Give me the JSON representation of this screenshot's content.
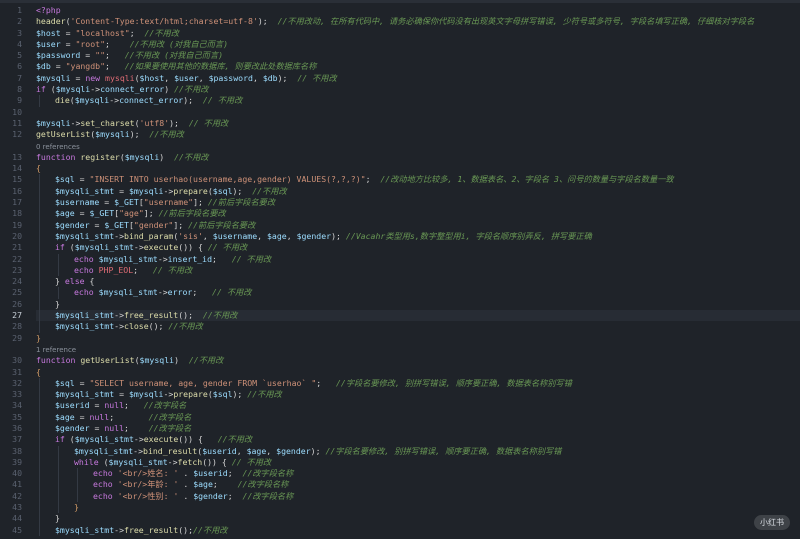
{
  "editor": {
    "lines": [
      {
        "n": "1",
        "tokens": [
          [
            "k",
            "<?php"
          ]
        ]
      },
      {
        "n": "2",
        "tokens": [
          [
            "f",
            "header"
          ],
          [
            "o",
            "("
          ],
          [
            "s",
            "'Content-Type:text/html;charset=utf-8'"
          ],
          [
            "o",
            ");  "
          ],
          [
            "c",
            "//不用改动, 在所有代码中, 请务必确保你代码没有出现英文字母拼写错误, 少符号或多符号, 字段名填写正确, 仔细核对字段名"
          ]
        ]
      },
      {
        "n": "3",
        "tokens": [
          [
            "v",
            "$host"
          ],
          [
            "o",
            " = "
          ],
          [
            "s",
            "\"localhost\""
          ],
          [
            "o",
            ";  "
          ],
          [
            "c",
            "//不用改"
          ]
        ]
      },
      {
        "n": "4",
        "tokens": [
          [
            "v",
            "$user"
          ],
          [
            "o",
            " = "
          ],
          [
            "s",
            "\"root\""
          ],
          [
            "o",
            ";    "
          ],
          [
            "c",
            "//不用改 (对我自己而言)"
          ]
        ]
      },
      {
        "n": "5",
        "tokens": [
          [
            "v",
            "$password"
          ],
          [
            "o",
            " = "
          ],
          [
            "s",
            "\"\""
          ],
          [
            "o",
            ";   "
          ],
          [
            "c",
            "//不用改 (对我自己而言)"
          ]
        ]
      },
      {
        "n": "6",
        "tokens": [
          [
            "v",
            "$db"
          ],
          [
            "o",
            " = "
          ],
          [
            "s",
            "\"yangdb\""
          ],
          [
            "o",
            ";   "
          ],
          [
            "c",
            "//如果要使用其他的数据库, 则要改此处数据库名称"
          ]
        ]
      },
      {
        "n": "7",
        "tokens": [
          [
            "v",
            "$mysqli"
          ],
          [
            "o",
            " = "
          ],
          [
            "k",
            "new "
          ],
          [
            "r",
            "mysqli"
          ],
          [
            "o",
            "("
          ],
          [
            "v",
            "$host"
          ],
          [
            "o",
            ", "
          ],
          [
            "v",
            "$user"
          ],
          [
            "o",
            ", "
          ],
          [
            "v",
            "$password"
          ],
          [
            "o",
            ", "
          ],
          [
            "v",
            "$db"
          ],
          [
            "o",
            ");  "
          ],
          [
            "c",
            "// 不用改"
          ]
        ]
      },
      {
        "n": "8",
        "tokens": [
          [
            "k",
            "if "
          ],
          [
            "o",
            "("
          ],
          [
            "v",
            "$mysqli"
          ],
          [
            "o",
            "->"
          ],
          [
            "v",
            "connect_error"
          ],
          [
            "o",
            ") "
          ],
          [
            "c",
            "//不用改"
          ]
        ]
      },
      {
        "n": "9",
        "indent": 1,
        "tokens": [
          [
            "f",
            "die"
          ],
          [
            "o",
            "("
          ],
          [
            "v",
            "$mysqli"
          ],
          [
            "o",
            "->"
          ],
          [
            "v",
            "connect_error"
          ],
          [
            "o",
            ");  "
          ],
          [
            "c",
            "// 不用改"
          ]
        ]
      },
      {
        "n": "10",
        "tokens": []
      },
      {
        "n": "11",
        "tokens": [
          [
            "v",
            "$mysqli"
          ],
          [
            "o",
            "->"
          ],
          [
            "f",
            "set_charset"
          ],
          [
            "o",
            "("
          ],
          [
            "s",
            "'utf8'"
          ],
          [
            "o",
            ");  "
          ],
          [
            "c",
            "// 不用改"
          ]
        ]
      },
      {
        "n": "12",
        "tokens": [
          [
            "f",
            "getUserList"
          ],
          [
            "o",
            "("
          ],
          [
            "v",
            "$mysqli"
          ],
          [
            "o",
            ");  "
          ],
          [
            "c",
            "//不用改"
          ]
        ]
      },
      {
        "ref": "0 references"
      },
      {
        "n": "13",
        "tokens": [
          [
            "k",
            "function "
          ],
          [
            "f",
            "register"
          ],
          [
            "o",
            "("
          ],
          [
            "v",
            "$mysqli"
          ],
          [
            "o",
            ")  "
          ],
          [
            "c",
            "//不用改"
          ]
        ]
      },
      {
        "n": "14",
        "tokens": [
          [
            "b",
            "{"
          ]
        ]
      },
      {
        "n": "15",
        "indent": 1,
        "tokens": [
          [
            "v",
            "$sql"
          ],
          [
            "o",
            " = "
          ],
          [
            "s",
            "\"INSERT INTO userhao(username,age,gender) VALUES(?,?,?)\""
          ],
          [
            "o",
            ";  "
          ],
          [
            "c",
            "//改动地方比较多, 1、数据表名、2、字段名 3、问号的数量与字段名数量一致"
          ]
        ]
      },
      {
        "n": "16",
        "indent": 1,
        "tokens": [
          [
            "v",
            "$mysqli_stmt"
          ],
          [
            "o",
            " = "
          ],
          [
            "v",
            "$mysqli"
          ],
          [
            "o",
            "->"
          ],
          [
            "f",
            "prepare"
          ],
          [
            "o",
            "("
          ],
          [
            "v",
            "$sql"
          ],
          [
            "o",
            ");  "
          ],
          [
            "c",
            "//不用改"
          ]
        ]
      },
      {
        "n": "17",
        "indent": 1,
        "tokens": [
          [
            "v",
            "$username"
          ],
          [
            "o",
            " = "
          ],
          [
            "v",
            "$_GET"
          ],
          [
            "o",
            "["
          ],
          [
            "s",
            "\"username\""
          ],
          [
            "o",
            "]; "
          ],
          [
            "c",
            "//前后字段名要改"
          ]
        ]
      },
      {
        "n": "18",
        "indent": 1,
        "tokens": [
          [
            "v",
            "$age"
          ],
          [
            "o",
            " = "
          ],
          [
            "v",
            "$_GET"
          ],
          [
            "o",
            "["
          ],
          [
            "s",
            "\"age\""
          ],
          [
            "o",
            "]; "
          ],
          [
            "c",
            "//前后字段名要改"
          ]
        ]
      },
      {
        "n": "19",
        "indent": 1,
        "tokens": [
          [
            "v",
            "$gender"
          ],
          [
            "o",
            " = "
          ],
          [
            "v",
            "$_GET"
          ],
          [
            "o",
            "["
          ],
          [
            "s",
            "\"gender\""
          ],
          [
            "o",
            "]; "
          ],
          [
            "c",
            "//前后字段名要改"
          ]
        ]
      },
      {
        "n": "20",
        "indent": 1,
        "tokens": [
          [
            "v",
            "$mysqli_stmt"
          ],
          [
            "o",
            "->"
          ],
          [
            "f",
            "bind_param"
          ],
          [
            "o",
            "("
          ],
          [
            "s",
            "'sis'"
          ],
          [
            "o",
            ", "
          ],
          [
            "v",
            "$username"
          ],
          [
            "o",
            ", "
          ],
          [
            "v",
            "$age"
          ],
          [
            "o",
            ", "
          ],
          [
            "v",
            "$gender"
          ],
          [
            "o",
            "); "
          ],
          [
            "c",
            "//Vacahr类型用s,数字整型用i, 字段名顺序别弄反, 拼写要正确"
          ]
        ]
      },
      {
        "n": "21",
        "indent": 1,
        "tokens": [
          [
            "k",
            "if "
          ],
          [
            "o",
            "("
          ],
          [
            "v",
            "$mysqli_stmt"
          ],
          [
            "o",
            "->"
          ],
          [
            "f",
            "execute"
          ],
          [
            "o",
            "()) { "
          ],
          [
            "c",
            "// 不用改"
          ]
        ]
      },
      {
        "n": "22",
        "indent": 2,
        "tokens": [
          [
            "k",
            "echo "
          ],
          [
            "v",
            "$mysqli_stmt"
          ],
          [
            "o",
            "->"
          ],
          [
            "v",
            "insert_id"
          ],
          [
            "o",
            ";   "
          ],
          [
            "c",
            "// 不用改"
          ]
        ]
      },
      {
        "n": "23",
        "indent": 2,
        "tokens": [
          [
            "k",
            "echo "
          ],
          [
            "r",
            "PHP_EOL"
          ],
          [
            "o",
            ";   "
          ],
          [
            "c",
            "// 不用改"
          ]
        ]
      },
      {
        "n": "24",
        "indent": 1,
        "tokens": [
          [
            "o",
            "} "
          ],
          [
            "k",
            "else "
          ],
          [
            "o",
            "{"
          ]
        ]
      },
      {
        "n": "25",
        "indent": 2,
        "tokens": [
          [
            "k",
            "echo "
          ],
          [
            "v",
            "$mysqli_stmt"
          ],
          [
            "o",
            "->"
          ],
          [
            "v",
            "error"
          ],
          [
            "o",
            ";   "
          ],
          [
            "c",
            "// 不用改"
          ]
        ]
      },
      {
        "n": "26",
        "indent": 1,
        "tokens": [
          [
            "o",
            "}"
          ]
        ]
      },
      {
        "n": "27",
        "indent": 1,
        "active": true,
        "tokens": [
          [
            "v",
            "$mysqli_stmt"
          ],
          [
            "o",
            "->"
          ],
          [
            "f",
            "free_result"
          ],
          [
            "o",
            "();  "
          ],
          [
            "c",
            "//不用改"
          ]
        ]
      },
      {
        "n": "28",
        "indent": 1,
        "tokens": [
          [
            "v",
            "$mysqli_stmt"
          ],
          [
            "o",
            "->"
          ],
          [
            "f",
            "close"
          ],
          [
            "o",
            "(); "
          ],
          [
            "c",
            "//不用改"
          ]
        ]
      },
      {
        "n": "29",
        "tokens": [
          [
            "b",
            "}"
          ]
        ]
      },
      {
        "ref": "1 reference"
      },
      {
        "n": "30",
        "tokens": [
          [
            "k",
            "function "
          ],
          [
            "f",
            "getUserList"
          ],
          [
            "o",
            "("
          ],
          [
            "v",
            "$mysqli"
          ],
          [
            "o",
            ")  "
          ],
          [
            "c",
            "//不用改"
          ]
        ]
      },
      {
        "n": "31",
        "tokens": [
          [
            "b",
            "{"
          ]
        ]
      },
      {
        "n": "32",
        "indent": 1,
        "tokens": [
          [
            "v",
            "$sql"
          ],
          [
            "o",
            " = "
          ],
          [
            "s",
            "\"SELECT username, age, gender FROM `userhao` \""
          ],
          [
            "o",
            ";   "
          ],
          [
            "c",
            "//字段名要修改, 别拼写错误, 顺序要正确, 数据表名称别写错"
          ]
        ]
      },
      {
        "n": "33",
        "indent": 1,
        "tokens": [
          [
            "v",
            "$mysqli_stmt"
          ],
          [
            "o",
            " = "
          ],
          [
            "v",
            "$mysqli"
          ],
          [
            "o",
            "->"
          ],
          [
            "f",
            "prepare"
          ],
          [
            "o",
            "("
          ],
          [
            "v",
            "$sql"
          ],
          [
            "o",
            "); "
          ],
          [
            "c",
            "//不用改"
          ]
        ]
      },
      {
        "n": "34",
        "indent": 1,
        "tokens": [
          [
            "v",
            "$userid"
          ],
          [
            "o",
            " = "
          ],
          [
            "k",
            "null"
          ],
          [
            "o",
            ";   "
          ],
          [
            "c",
            "//改字段名"
          ]
        ]
      },
      {
        "n": "35",
        "indent": 1,
        "tokens": [
          [
            "v",
            "$age"
          ],
          [
            "o",
            " = "
          ],
          [
            "k",
            "null"
          ],
          [
            "o",
            ";       "
          ],
          [
            "c",
            "//改字段名"
          ]
        ]
      },
      {
        "n": "36",
        "indent": 1,
        "tokens": [
          [
            "v",
            "$gender"
          ],
          [
            "o",
            " = "
          ],
          [
            "k",
            "null"
          ],
          [
            "o",
            ";    "
          ],
          [
            "c",
            "//改字段名"
          ]
        ]
      },
      {
        "n": "37",
        "indent": 1,
        "tokens": [
          [
            "k",
            "if "
          ],
          [
            "o",
            "("
          ],
          [
            "v",
            "$mysqli_stmt"
          ],
          [
            "o",
            "->"
          ],
          [
            "f",
            "execute"
          ],
          [
            "o",
            "()) {   "
          ],
          [
            "c",
            "//不用改"
          ]
        ]
      },
      {
        "n": "38",
        "indent": 2,
        "tokens": [
          [
            "v",
            "$mysqli_stmt"
          ],
          [
            "o",
            "->"
          ],
          [
            "f",
            "bind_result"
          ],
          [
            "o",
            "("
          ],
          [
            "v",
            "$userid"
          ],
          [
            "o",
            ", "
          ],
          [
            "v",
            "$age"
          ],
          [
            "o",
            ", "
          ],
          [
            "v",
            "$gender"
          ],
          [
            "o",
            "); "
          ],
          [
            "c",
            "//字段名要修改, 别拼写错误, 顺序要正确, 数据表名称别写错"
          ]
        ]
      },
      {
        "n": "39",
        "indent": 2,
        "tokens": [
          [
            "k",
            "while "
          ],
          [
            "o",
            "("
          ],
          [
            "v",
            "$mysqli_stmt"
          ],
          [
            "o",
            "->"
          ],
          [
            "f",
            "fetch"
          ],
          [
            "o",
            "()) { "
          ],
          [
            "c",
            "// 不用改"
          ]
        ]
      },
      {
        "n": "40",
        "indent": 3,
        "tokens": [
          [
            "k",
            "echo "
          ],
          [
            "s",
            "'<br/>姓名: '"
          ],
          [
            "o",
            " . "
          ],
          [
            "v",
            "$userid"
          ],
          [
            "o",
            ";  "
          ],
          [
            "c",
            "//改字段名称"
          ]
        ]
      },
      {
        "n": "41",
        "indent": 3,
        "tokens": [
          [
            "k",
            "echo "
          ],
          [
            "s",
            "'<br/>年龄: '"
          ],
          [
            "o",
            " . "
          ],
          [
            "v",
            "$age"
          ],
          [
            "o",
            ";    "
          ],
          [
            "c",
            "//改字段名称"
          ]
        ]
      },
      {
        "n": "42",
        "indent": 3,
        "tokens": [
          [
            "k",
            "echo "
          ],
          [
            "s",
            "'<br/>性别: '"
          ],
          [
            "o",
            " . "
          ],
          [
            "v",
            "$gender"
          ],
          [
            "o",
            ";  "
          ],
          [
            "c",
            "//改字段名称"
          ]
        ]
      },
      {
        "n": "43",
        "indent": 2,
        "tokens": [
          [
            "b",
            "}"
          ]
        ]
      },
      {
        "n": "44",
        "indent": 1,
        "tokens": [
          [
            "o",
            "}"
          ]
        ]
      },
      {
        "n": "45",
        "indent": 1,
        "tokens": [
          [
            "v",
            "$mysqli_stmt"
          ],
          [
            "o",
            "->"
          ],
          [
            "f",
            "free_result"
          ],
          [
            "o",
            "();"
          ],
          [
            "c",
            "//不用改"
          ]
        ]
      }
    ]
  },
  "watermark": "小红书"
}
